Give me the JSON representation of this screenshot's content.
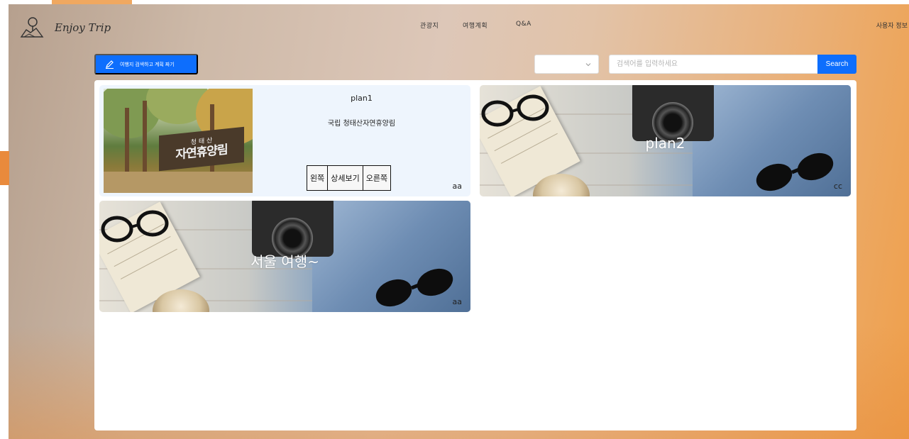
{
  "brand": {
    "name": "Enjoy Trip"
  },
  "nav": {
    "items": [
      {
        "label": "관광지"
      },
      {
        "label": "여행계획"
      },
      {
        "label": "Q&A"
      }
    ],
    "user_label": "사용자 정보"
  },
  "toolbar": {
    "plan_button_label": "여행지 검색하고 계획 짜기",
    "select_value": "",
    "search_placeholder": "검색어를 입력하세요",
    "search_value": "",
    "search_button_label": "Search"
  },
  "plans": [
    {
      "title": "plan1",
      "description": "국립 청태산자연휴양림",
      "photo_sign_small": "청 태 산",
      "photo_sign_big": "자연휴양림",
      "buttons": {
        "left": "왼쪽",
        "detail": "상세보기",
        "right": "오른쪽"
      },
      "owner": "aa"
    },
    {
      "title": "plan2",
      "owner": "cc"
    },
    {
      "title": "서울 여행~",
      "owner": "aa"
    }
  ],
  "colors": {
    "primary": "#0d6efd",
    "accent_orange": "#ef9f4a",
    "card_highlight": "#eef5fd"
  },
  "icons": {
    "logo": "map-pin-logo-icon",
    "plan_button": "pencil-icon",
    "select": "chevron-down-icon"
  }
}
